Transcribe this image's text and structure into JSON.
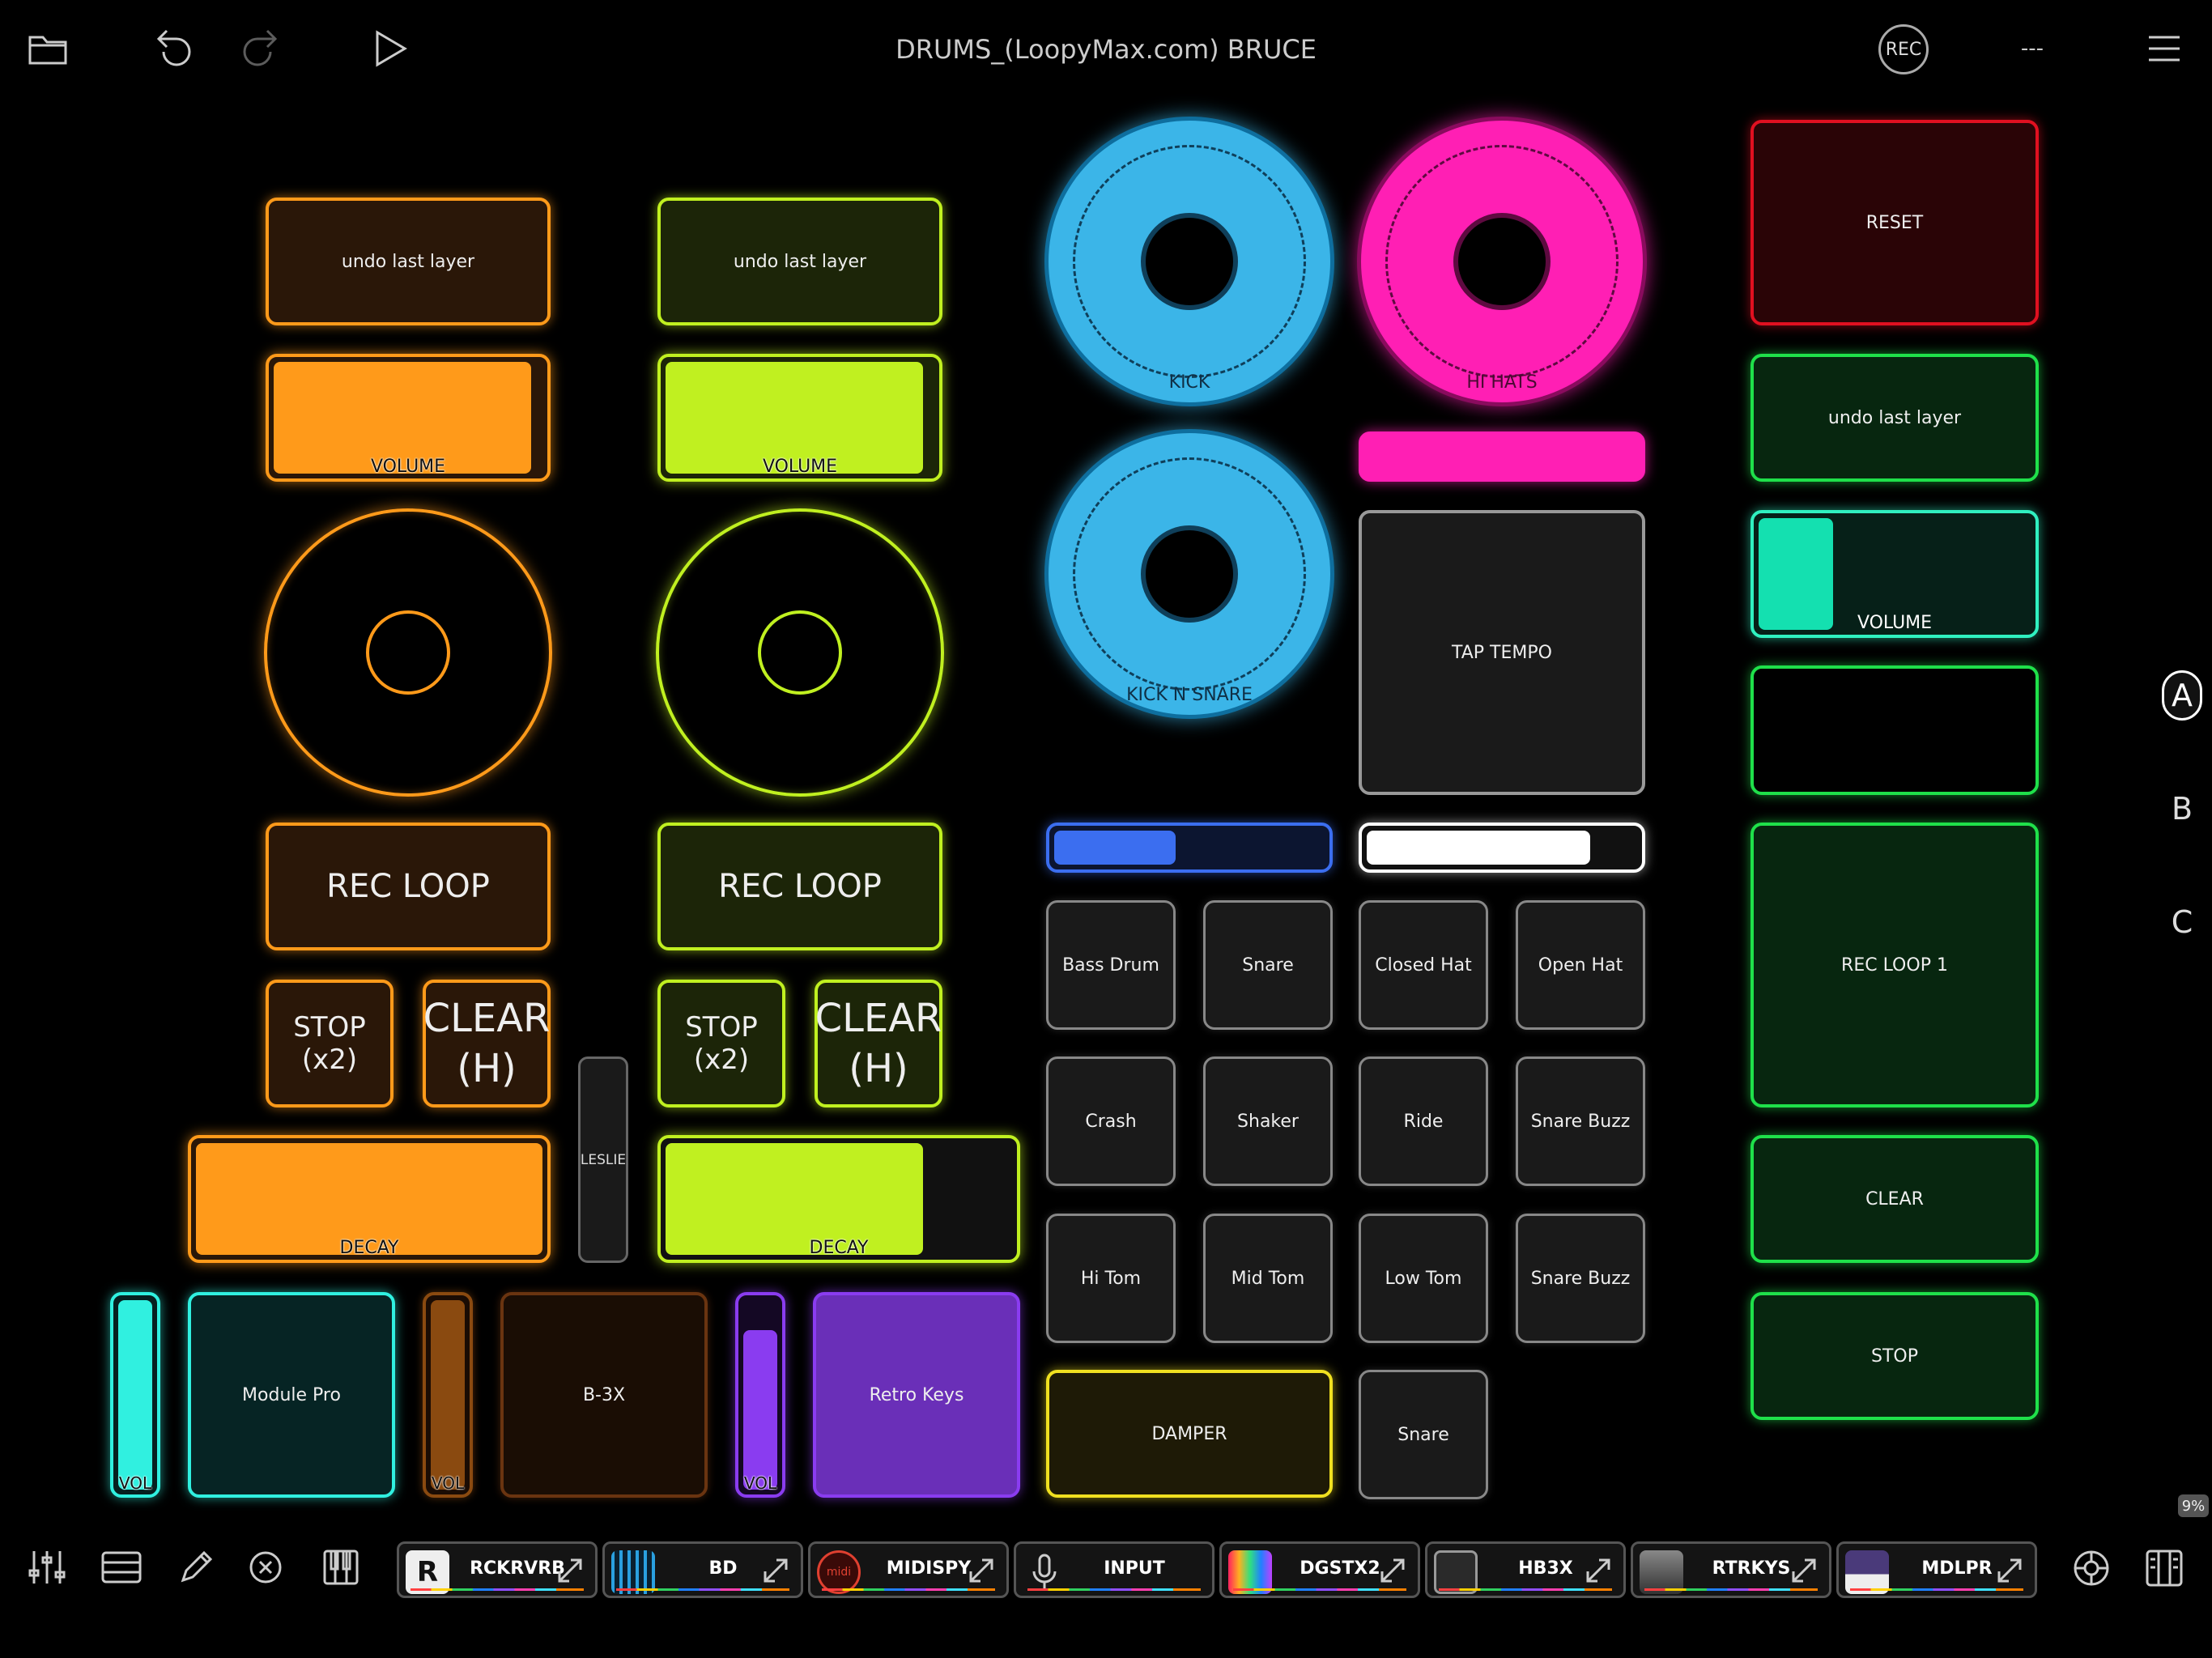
{
  "header": {
    "title": "DRUMS_(LoopyMax.com) BRUCE",
    "rec_label": "REC",
    "status": "---"
  },
  "col1": {
    "color": "#ff9a1a",
    "undo": "undo last layer",
    "volume_label": "VOLUME",
    "volume_level": 0.96,
    "rec_loop": "REC LOOP",
    "stop": "STOP (x2)",
    "clear_line1": "CLEAR",
    "clear_line2": "(H)",
    "decay_label": "DECAY",
    "decay_level": 1.0
  },
  "col2": {
    "color": "#c0f020",
    "undo": "undo last layer",
    "volume_label": "VOLUME",
    "volume_level": 0.96,
    "rec_loop": "REC LOOP",
    "stop": "STOP (x2)",
    "clear_line1": "CLEAR",
    "clear_line2": "(H)",
    "decay_label": "DECAY",
    "decay_level": 0.75
  },
  "leslie": "LESLIE",
  "loops": {
    "kick": "KICK",
    "hihats": "HI HATS",
    "kick_snare": "KICK N SNARE"
  },
  "tap_tempo": "TAP TEMPO",
  "pads": [
    [
      "Bass Drum",
      "Snare",
      "Closed Hat",
      "Open Hat"
    ],
    [
      "Crash",
      "Shaker",
      "Ride",
      "Snare Buzz"
    ],
    [
      "Hi Tom",
      "Mid Tom",
      "Low Tom",
      "Snare Buzz"
    ]
  ],
  "damper": "DAMPER",
  "snare_extra": "Snare",
  "right": {
    "reset": "RESET",
    "undo": "undo last layer",
    "volume_label": "VOLUME",
    "volume_level": 0.3,
    "rec_loop": "REC LOOP 1",
    "clear": "CLEAR",
    "stop": "STOP"
  },
  "side_tabs": [
    "A",
    "B",
    "C"
  ],
  "instruments": {
    "vol1": "VOL",
    "vol1_level": 1.0,
    "module_pro": "Module Pro",
    "vol2": "VOL",
    "vol2_level": 1.0,
    "b3x": "B-3X",
    "vol3": "VOL",
    "vol3_level": 0.85,
    "retro_keys": "Retro Keys"
  },
  "cpu": "9%",
  "plugins": [
    {
      "name": "RCKRVRB",
      "icon": "R"
    },
    {
      "name": "BD",
      "icon": ""
    },
    {
      "name": "MIDISPY",
      "icon": "midi"
    },
    {
      "name": "INPUT",
      "icon": ""
    },
    {
      "name": "DGSTX2",
      "icon": ""
    },
    {
      "name": "HB3X",
      "icon": ""
    },
    {
      "name": "RTRKYS",
      "icon": ""
    },
    {
      "name": "MDLPR",
      "icon": ""
    }
  ],
  "colors": {
    "orange": "#ff9a1a",
    "lime": "#c0f020",
    "blue": "#3bb5e8",
    "pink": "#ff1fb4",
    "green": "#1fe04a",
    "red": "#e01020",
    "teal": "#30f0c0",
    "purple": "#8a3cf0"
  }
}
